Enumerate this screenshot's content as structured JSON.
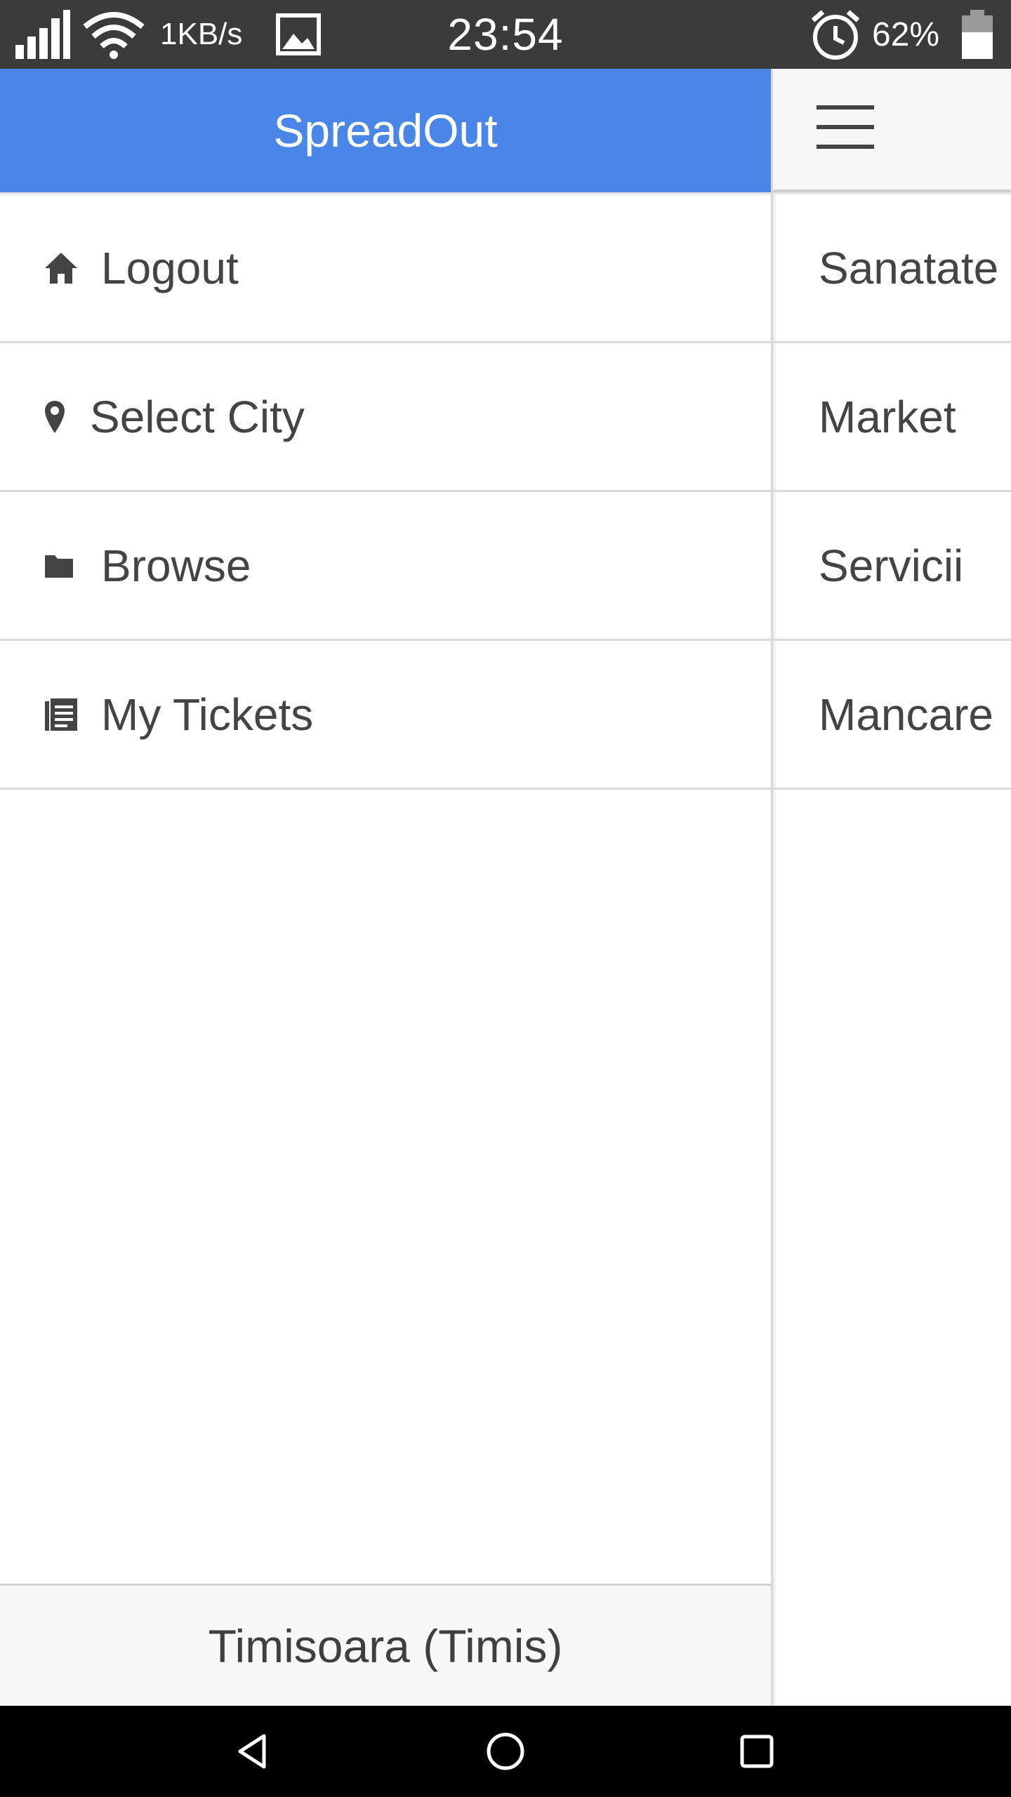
{
  "status_bar": {
    "net_speed": "1KB/s",
    "time": "23:54",
    "battery_percent": "62%",
    "icons": [
      "signal-icon",
      "wifi-icon",
      "gallery-icon",
      "alarm-icon",
      "battery-icon"
    ]
  },
  "drawer": {
    "title": "SpreadOut",
    "items": [
      {
        "label": "Logout",
        "icon": "home-icon"
      },
      {
        "label": "Select City",
        "icon": "map-marker-icon"
      },
      {
        "label": "Browse",
        "icon": "folder-icon"
      },
      {
        "label": "My Tickets",
        "icon": "list-icon"
      }
    ],
    "footer_city": "Timisoara (Timis)"
  },
  "main": {
    "menu_icon": "hamburger-icon",
    "categories": [
      "Sanatate",
      "Market",
      "Servicii",
      "Mancare"
    ]
  },
  "nav_bar": {
    "buttons": [
      "back-icon",
      "home-circle-icon",
      "recents-icon"
    ]
  },
  "colors": {
    "header_blue": "#4a86e8",
    "status_bar": "#3b3b3b",
    "text": "#444444",
    "footer_bg": "#f7f7f7"
  }
}
